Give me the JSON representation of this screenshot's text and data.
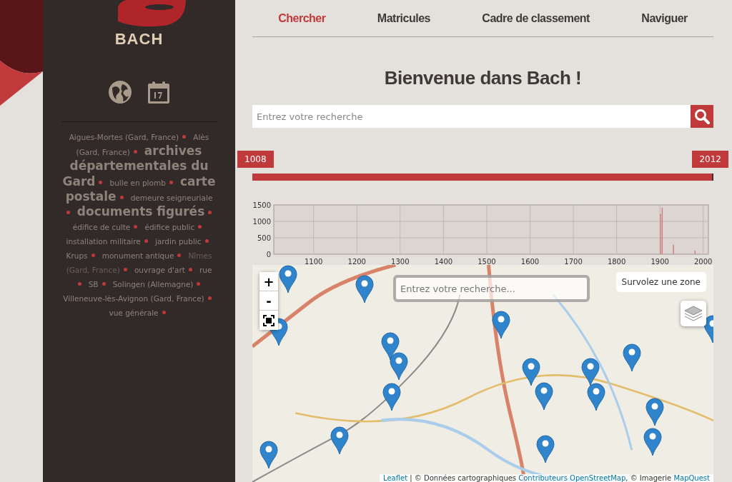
{
  "logo": {
    "title": "BACH"
  },
  "nav": {
    "tabs": [
      {
        "label": "Chercher",
        "selected": true
      },
      {
        "label": "Matricules",
        "selected": false
      },
      {
        "label": "Cadre de classement",
        "selected": false
      },
      {
        "label": "Naviguer",
        "selected": false
      }
    ]
  },
  "heading": "Bienvenue dans Bach !",
  "search": {
    "placeholder": "Entrez votre recherche"
  },
  "range": {
    "start": "1008",
    "end": "2012"
  },
  "tags": [
    {
      "label": "Aigues-Mortes (Gard, France)",
      "kind": "minor"
    },
    {
      "label": "Alès (Gard, France)",
      "kind": "minor"
    },
    {
      "label": "archives départementales du Gard",
      "kind": "major"
    },
    {
      "label": "bulle en plomb",
      "kind": "minor"
    },
    {
      "label": "carte postale",
      "kind": "major"
    },
    {
      "label": "demeure seigneuriale",
      "kind": "minor"
    },
    {
      "label": "documents figurés",
      "kind": "major"
    },
    {
      "label": "édifice de culte",
      "kind": "minor"
    },
    {
      "label": "édifice public",
      "kind": "minor"
    },
    {
      "label": "installation militaire",
      "kind": "minor"
    },
    {
      "label": "jardin public",
      "kind": "minor"
    },
    {
      "label": "Krups",
      "kind": "minor"
    },
    {
      "label": "monument antique",
      "kind": "minor"
    },
    {
      "label": "Nîmes (Gard, France)",
      "kind": "faded"
    },
    {
      "label": "ouvrage d'art",
      "kind": "minor"
    },
    {
      "label": "rue",
      "kind": "minor"
    },
    {
      "label": "SB",
      "kind": "minor"
    },
    {
      "label": "Solingen (Allemagne)",
      "kind": "minor"
    },
    {
      "label": "Villeneuve-lès-Avignon (Gard, France)",
      "kind": "minor"
    },
    {
      "label": "vue générale",
      "kind": "minor"
    }
  ],
  "timeline": {
    "chart_data": {
      "type": "bar",
      "x": [
        1900,
        1904,
        1930,
        1980
      ],
      "grid": true,
      "series": [
        {
          "color": "#d08080",
          "values": [
            1230,
            1420,
            290,
            110
          ]
        }
      ],
      "xlim": [
        1008,
        2012
      ],
      "ylim": [
        0,
        1500
      ],
      "xticks": [
        1100,
        1200,
        1300,
        1400,
        1500,
        1600,
        1700,
        1800,
        1900,
        2000
      ],
      "yticks": [
        0,
        500,
        1000,
        1500
      ]
    }
  },
  "map": {
    "zoom_in": "+",
    "zoom_out": "-",
    "search": {
      "placeholder": "Entrez votre recherche..."
    },
    "hover_hint": "Survolez une zone",
    "attribution": [
      {
        "text": "Leaflet",
        "kind": "link"
      },
      {
        "text": " | © Données cartographiques ",
        "kind": "text"
      },
      {
        "text": "Contributeurs OpenStreetMap",
        "kind": "link"
      },
      {
        "text": ", © Imagerie ",
        "kind": "text"
      },
      {
        "text": "MapQuest",
        "kind": "link"
      }
    ]
  }
}
